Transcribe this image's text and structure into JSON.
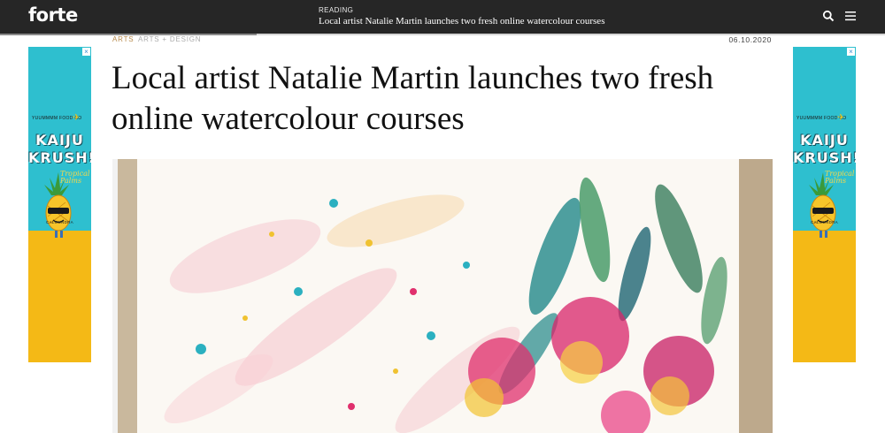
{
  "header": {
    "logo": "forte",
    "reading_label": "READING",
    "reading_title": "Local artist Natalie Martin launches two fresh online watercolour courses",
    "reading_progress": 0.29,
    "icons": [
      "search-icon",
      "menu-icon"
    ]
  },
  "article": {
    "categories": [
      "ARTS",
      "ARTS + DESIGN"
    ],
    "date": "06.10.2020",
    "title": "Local artist Natalie Martin launches two fresh online watercolour courses"
  },
  "ads": {
    "brand": "YUUMMMM FOOD CO",
    "line1": "KAIJU",
    "line2": "KRUSH!",
    "tagline": "Tropical Palms",
    "address": "CALOUNDRA",
    "close": "×"
  },
  "colors": {
    "topbar": "#262626",
    "category_accent": "#b88a4a",
    "ad_sky": "#2ebfcf",
    "ad_sand": "#f4b916"
  }
}
